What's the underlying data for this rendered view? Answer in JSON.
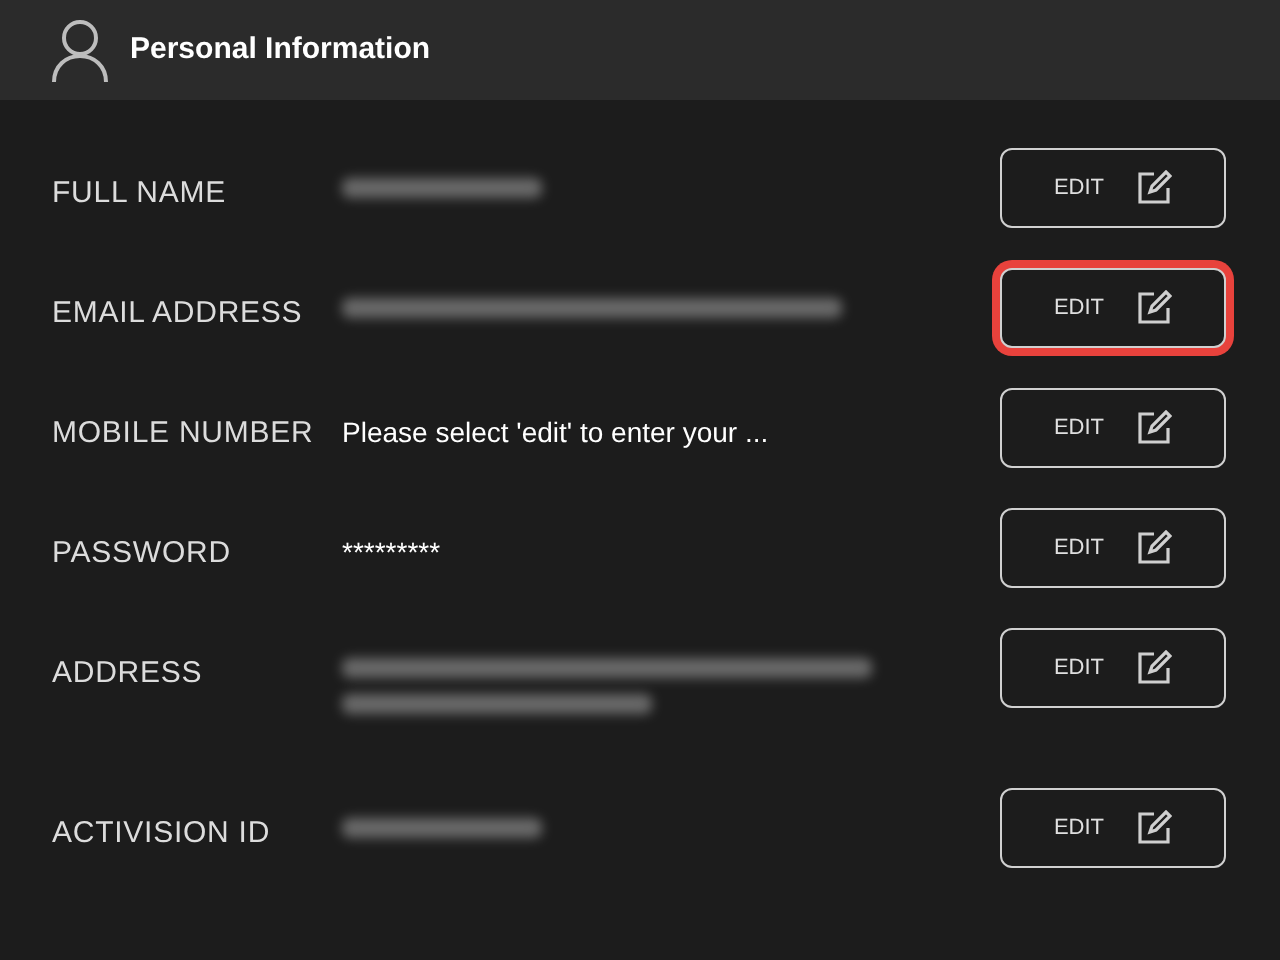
{
  "header": {
    "title": "Personal Information"
  },
  "rows": [
    {
      "label": "FULL NAME",
      "value": {
        "kind": "blurred_short"
      },
      "button": "EDIT",
      "highlighted": false
    },
    {
      "label": "EMAIL ADDRESS",
      "value": {
        "kind": "blurred_long"
      },
      "button": "EDIT",
      "highlighted": true
    },
    {
      "label": "MOBILE NUMBER",
      "value": {
        "kind": "text",
        "text": "Please select 'edit' to enter your ..."
      },
      "button": "EDIT",
      "highlighted": false
    },
    {
      "label": "PASSWORD",
      "value": {
        "kind": "text",
        "text": "*********"
      },
      "button": "EDIT",
      "highlighted": false
    },
    {
      "label": "ADDRESS",
      "value": {
        "kind": "blurred_two_line"
      },
      "button": "EDIT",
      "highlighted": false
    },
    {
      "label": "ACTIVISION ID",
      "value": {
        "kind": "blurred_short"
      },
      "button": "EDIT",
      "highlighted": false
    }
  ]
}
